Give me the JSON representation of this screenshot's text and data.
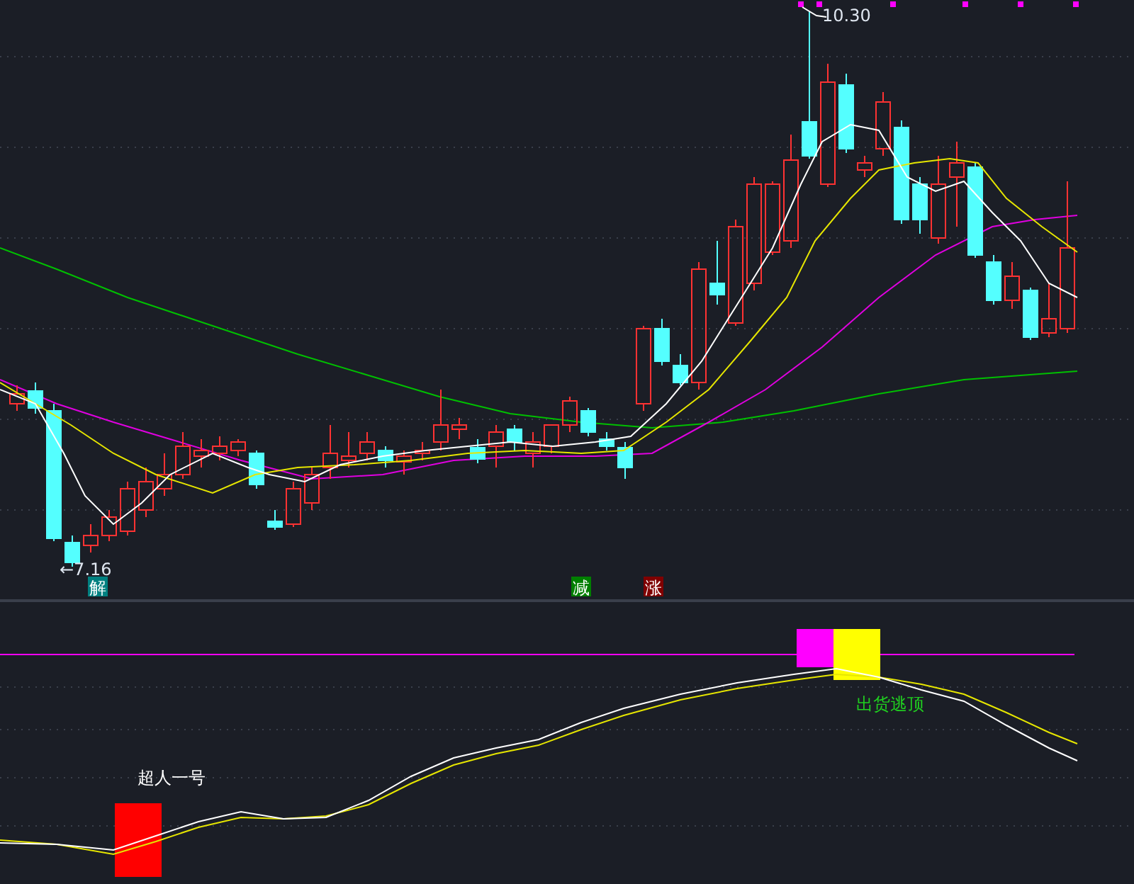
{
  "price_pane": {
    "high_label": "10.30",
    "low_label": "←7.16",
    "signals": [
      {
        "text": "解",
        "color": "#008080"
      },
      {
        "text": "减",
        "color": "#007f00"
      },
      {
        "text": "涨",
        "color": "#800000"
      }
    ]
  },
  "indicator_pane": {
    "labels": [
      {
        "kind": "white",
        "text": "超人一号"
      },
      {
        "kind": "green",
        "text": "出货逃顶"
      }
    ]
  }
}
